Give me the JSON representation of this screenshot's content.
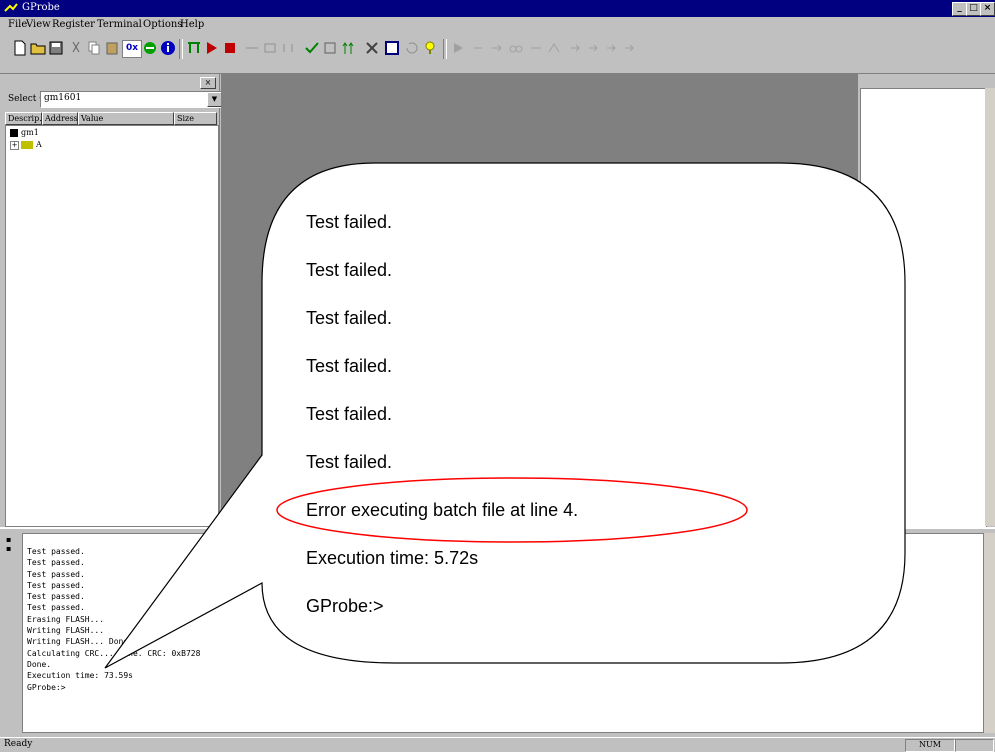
{
  "window": {
    "title": "GProbe",
    "controls": [
      "_",
      "□",
      "×"
    ]
  },
  "menu": [
    "File",
    "View",
    "Register",
    "Terminal",
    "Options",
    "Help"
  ],
  "toolbar": {
    "hex_label": "0x"
  },
  "leftpanel": {
    "chip_label": "Select Chip",
    "chip_value": "gm1601",
    "columns": [
      "Descrip...",
      "Address",
      "Value",
      "Size"
    ],
    "tree": [
      "gm1",
      "A"
    ]
  },
  "console": {
    "lines": [
      "Test passed.",
      "Test passed.",
      "Test passed.",
      "Test passed.",
      "Test passed.",
      "Test passed.",
      "Erasing FLASH...",
      "Writing FLASH...",
      "Writing FLASH... Done.",
      "Calculating CRC... Done. CRC: 0xB728",
      "Done.",
      "Execution time: 73.59s",
      "GProbe:>"
    ]
  },
  "statusbar": {
    "text": "Ready",
    "num": "NUM"
  },
  "callout": {
    "lines": [
      "Test failed.",
      "Test failed.",
      "Test failed.",
      "Test failed.",
      "Test failed.",
      "Test failed.",
      "Error executing batch file at line 4.",
      "Execution time: 5.72s",
      "GProbe:>"
    ],
    "highlight_color": "#ff0000"
  }
}
